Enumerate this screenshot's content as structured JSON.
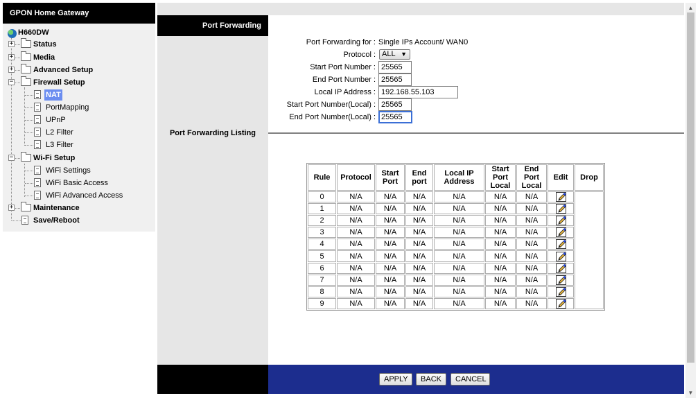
{
  "app_title": "GPON Home Gateway",
  "nav": {
    "root": "H660DW",
    "items": {
      "status": "Status",
      "media": "Media",
      "advanced_setup": "Advanced Setup",
      "firewall_setup": "Firewall Setup",
      "nat": "NAT",
      "portmapping": "PortMapping",
      "upnp": "UPnP",
      "l2_filter": "L2 Filter",
      "l3_filter": "L3 Filter",
      "wifi_setup": "Wi-Fi Setup",
      "wifi_settings": "WiFi Settings",
      "wifi_basic_access": "WiFi Basic Access",
      "wifi_advanced_access": "WiFi Advanced Access",
      "maintenance": "Maintenance",
      "save_reboot": "Save/Reboot"
    },
    "selected": "NAT"
  },
  "section": {
    "title": "Port Forwarding",
    "listing_title": "Port Forwarding Listing"
  },
  "form": {
    "for_label": "Port Forwarding for :",
    "for_value": "Single IPs Account/ WAN0",
    "protocol_label": "Protocol :",
    "protocol_value": "ALL",
    "start_port_label": "Start Port Number :",
    "start_port_value": "25565",
    "end_port_label": "End Port Number :",
    "end_port_value": "25565",
    "local_ip_label": "Local IP Address :",
    "local_ip_value": "192.168.55.103",
    "start_port_local_label": "Start Port Number(Local) :",
    "start_port_local_value": "25565",
    "end_port_local_label": "End Port Number(Local) :",
    "end_port_local_value": "25565"
  },
  "table": {
    "headers": {
      "rule": "Rule",
      "protocol": "Protocol",
      "start_port": [
        "Start",
        "Port"
      ],
      "end_port": [
        "End",
        "port"
      ],
      "local_ip": [
        "Local IP",
        "Address"
      ],
      "start_port_local": [
        "Start",
        "Port",
        "Local"
      ],
      "end_port_local": [
        "End",
        "Port",
        "Local"
      ],
      "edit": "Edit",
      "drop": "Drop"
    },
    "rows": [
      {
        "rule": "0",
        "protocol": "N/A",
        "start_port": "N/A",
        "end_port": "N/A",
        "local_ip": "N/A",
        "start_port_local": "N/A",
        "end_port_local": "N/A"
      },
      {
        "rule": "1",
        "protocol": "N/A",
        "start_port": "N/A",
        "end_port": "N/A",
        "local_ip": "N/A",
        "start_port_local": "N/A",
        "end_port_local": "N/A"
      },
      {
        "rule": "2",
        "protocol": "N/A",
        "start_port": "N/A",
        "end_port": "N/A",
        "local_ip": "N/A",
        "start_port_local": "N/A",
        "end_port_local": "N/A"
      },
      {
        "rule": "3",
        "protocol": "N/A",
        "start_port": "N/A",
        "end_port": "N/A",
        "local_ip": "N/A",
        "start_port_local": "N/A",
        "end_port_local": "N/A"
      },
      {
        "rule": "4",
        "protocol": "N/A",
        "start_port": "N/A",
        "end_port": "N/A",
        "local_ip": "N/A",
        "start_port_local": "N/A",
        "end_port_local": "N/A"
      },
      {
        "rule": "5",
        "protocol": "N/A",
        "start_port": "N/A",
        "end_port": "N/A",
        "local_ip": "N/A",
        "start_port_local": "N/A",
        "end_port_local": "N/A"
      },
      {
        "rule": "6",
        "protocol": "N/A",
        "start_port": "N/A",
        "end_port": "N/A",
        "local_ip": "N/A",
        "start_port_local": "N/A",
        "end_port_local": "N/A"
      },
      {
        "rule": "7",
        "protocol": "N/A",
        "start_port": "N/A",
        "end_port": "N/A",
        "local_ip": "N/A",
        "start_port_local": "N/A",
        "end_port_local": "N/A"
      },
      {
        "rule": "8",
        "protocol": "N/A",
        "start_port": "N/A",
        "end_port": "N/A",
        "local_ip": "N/A",
        "start_port_local": "N/A",
        "end_port_local": "N/A"
      },
      {
        "rule": "9",
        "protocol": "N/A",
        "start_port": "N/A",
        "end_port": "N/A",
        "local_ip": "N/A",
        "start_port_local": "N/A",
        "end_port_local": "N/A"
      }
    ]
  },
  "buttons": {
    "apply": "APPLY",
    "back": "BACK",
    "cancel": "CANCEL"
  },
  "icons": {
    "expander": "plus-minus-box-icon",
    "folder": "folder-icon",
    "page": "document-icon",
    "globe": "globe-icon",
    "edit": "pencil-edit-icon"
  },
  "colors": {
    "header_black": "#000000",
    "bottom_bar": "#1c2d8e",
    "selected_item": "#6b8df0",
    "panel_gray": "#e6e6e6",
    "nav_gray": "#f0f0f0"
  }
}
